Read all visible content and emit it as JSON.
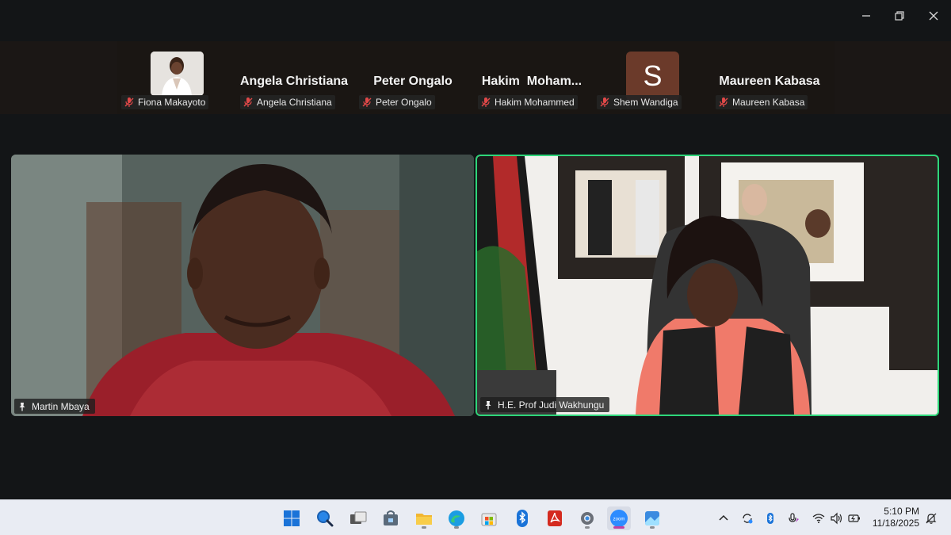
{
  "window": {
    "minimize": "minimize",
    "restore": "restore",
    "close": "close"
  },
  "participants": [
    {
      "label": "Fiona Makayoto",
      "display": "photo",
      "muted": true
    },
    {
      "label": "Angela Christiana",
      "big_name": "Angela Christiana",
      "muted": true
    },
    {
      "label": "Peter Ongalo",
      "big_name": "Peter Ongalo",
      "muted": true
    },
    {
      "label": "Hakim Mohammed",
      "big_name": "Hakim  Moham...",
      "muted": true
    },
    {
      "label": "Shem Wandiga",
      "avatar_letter": "S",
      "avatar_color": "#6b3a2a",
      "muted": true
    },
    {
      "label": "Maureen Kabasa",
      "big_name": "Maureen Kabasa",
      "muted": true
    }
  ],
  "videos": {
    "left": {
      "name": "Martin Mbaya",
      "pinned": true
    },
    "right": {
      "name": "H.E. Prof Judi Wakhungu",
      "pinned": true,
      "active_speaker_color": "#2ed67a"
    }
  },
  "taskbar": {
    "apps": [
      "windows-start",
      "search",
      "task-view",
      "store-bag",
      "file-explorer",
      "edge",
      "microsoft-store",
      "bluetooth",
      "acrobat",
      "settings",
      "zoom",
      "photos"
    ],
    "zoom_label": "zoom"
  },
  "tray": {
    "time": "5:10 PM",
    "date": "11/18/2025",
    "icons": [
      "chevron-up",
      "sync",
      "bluetooth",
      "mic",
      "wifi",
      "volume",
      "battery",
      "notification"
    ]
  }
}
